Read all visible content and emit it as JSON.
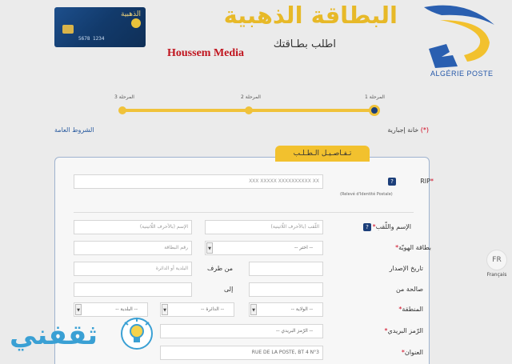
{
  "header": {
    "card_name": "الذهبية",
    "card_number": "5678 1234",
    "title": "البطاقة الذهبية",
    "subtitle": "اطلب بطـاقتك",
    "watermark": "Houssem Media",
    "brand": "ALGÉRIE POSTE"
  },
  "stepper": {
    "steps": [
      "المرحلة 1",
      "المرحلة 2",
      "المرحلة 3"
    ]
  },
  "notes": {
    "optional_star": "(*)",
    "optional": "خانة إجبارية",
    "terms": "الشروط العامة"
  },
  "section": {
    "tab": "تـفـاصـيـل الـطـلـب"
  },
  "form": {
    "rip_label": "RIP",
    "rip_star": "*",
    "rip_placeholder": "XXX XXXXX XXXXXXXXXX XX",
    "rip_note": "(Relevé d'Identité Postale)",
    "name_label": "الإسم واللّقب",
    "name_star": "*",
    "lastname_placeholder": "اللّقب (بالأحرف اللّاتينية)",
    "firstname_placeholder": "الإسم (بالأحرف اللّاتينية)",
    "id_label": "بطاقة الهويّة",
    "id_star": "*",
    "id_type": "-- اختر --",
    "id_number_placeholder": "رقم البطاقة",
    "issue_label": "تاريخ الإصدار",
    "issued_by": "من طرف",
    "issued_by_placeholder": "البلدية أو الدائرة",
    "valid_label": "صالحة من",
    "to_label": "إلى",
    "region_label": "المنطقة",
    "region_star": "*",
    "wilaya": "-- الولاية --",
    "daira": "-- الدائرة --",
    "commune": "-- البلدية --",
    "postal_label": "الرّمز البريدي",
    "postal_star": "*",
    "postal_placeholder": "-- الرّمز البريدي --",
    "address_label": "العنوان",
    "address_star": "*",
    "address_value": "RUE DE LA POSTE, BT 4 N°3"
  },
  "language": {
    "code": "FR",
    "name": "Français"
  },
  "footer_logo": {
    "text": "ثقفني"
  },
  "colors": {
    "accent": "#f2c12e",
    "brand_blue": "#1c3f7a",
    "required": "#d0021b"
  }
}
